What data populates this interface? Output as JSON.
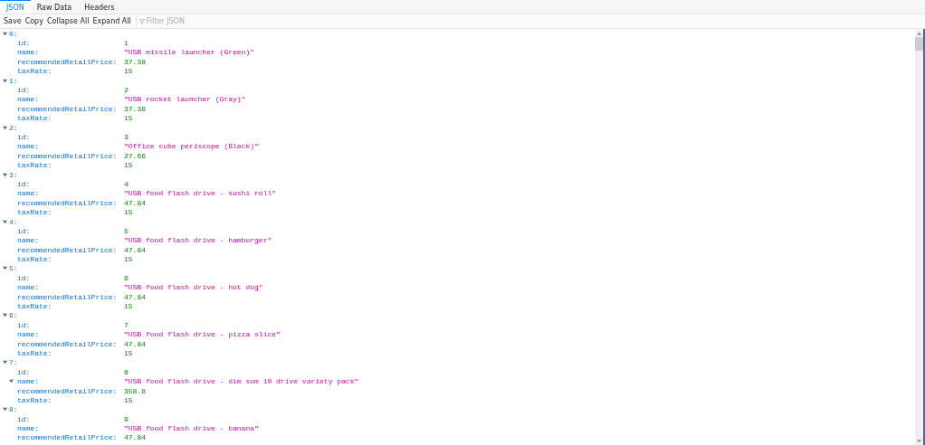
{
  "tabs": [
    {
      "label": "JSON",
      "selected": true
    },
    {
      "label": "Raw Data",
      "selected": false
    },
    {
      "label": "Headers",
      "selected": false
    }
  ],
  "toolbar": {
    "buttons": [
      "Save",
      "Copy",
      "Collapse All",
      "Expand All"
    ],
    "filter": {
      "placeholder": "Filter JSON"
    }
  },
  "items": [
    {
      "index": "0:",
      "fields": [
        {
          "key": "id:",
          "value": "1",
          "kind": "number"
        },
        {
          "key": "name:",
          "value": "\"USB missile launcher (Green)\"",
          "kind": "string"
        },
        {
          "key": "recommendedRetailPrice:",
          "value": "37.38",
          "kind": "number"
        },
        {
          "key": "taxRate:",
          "value": "15",
          "kind": "number"
        }
      ]
    },
    {
      "index": "1:",
      "fields": [
        {
          "key": "id:",
          "value": "2",
          "kind": "number"
        },
        {
          "key": "name:",
          "value": "\"USB rocket launcher (Gray)\"",
          "kind": "string"
        },
        {
          "key": "recommendedRetailPrice:",
          "value": "37.38",
          "kind": "number"
        },
        {
          "key": "taxRate:",
          "value": "15",
          "kind": "number"
        }
      ]
    },
    {
      "index": "2:",
      "fields": [
        {
          "key": "id:",
          "value": "3",
          "kind": "number"
        },
        {
          "key": "name:",
          "value": "\"Office cube periscope (Black)\"",
          "kind": "string"
        },
        {
          "key": "recommendedRetailPrice:",
          "value": "27.66",
          "kind": "number"
        },
        {
          "key": "taxRate:",
          "value": "15",
          "kind": "number"
        }
      ]
    },
    {
      "index": "3:",
      "fields": [
        {
          "key": "id:",
          "value": "4",
          "kind": "number"
        },
        {
          "key": "name:",
          "value": "\"USB food flash drive - sushi roll\"",
          "kind": "string"
        },
        {
          "key": "recommendedRetailPrice:",
          "value": "47.84",
          "kind": "number"
        },
        {
          "key": "taxRate:",
          "value": "15",
          "kind": "number"
        }
      ]
    },
    {
      "index": "4:",
      "fields": [
        {
          "key": "id:",
          "value": "5",
          "kind": "number"
        },
        {
          "key": "name:",
          "value": "\"USB food flash drive - hamburger\"",
          "kind": "string"
        },
        {
          "key": "recommendedRetailPrice:",
          "value": "47.84",
          "kind": "number"
        },
        {
          "key": "taxRate:",
          "value": "15",
          "kind": "number"
        }
      ]
    },
    {
      "index": "5:",
      "fields": [
        {
          "key": "id:",
          "value": "6",
          "kind": "number"
        },
        {
          "key": "name:",
          "value": "\"USB food flash drive - hot dog\"",
          "kind": "string"
        },
        {
          "key": "recommendedRetailPrice:",
          "value": "47.84",
          "kind": "number"
        },
        {
          "key": "taxRate:",
          "value": "15",
          "kind": "number"
        }
      ]
    },
    {
      "index": "6:",
      "fields": [
        {
          "key": "id:",
          "value": "7",
          "kind": "number"
        },
        {
          "key": "name:",
          "value": "\"USB food flash drive - pizza slice\"",
          "kind": "string"
        },
        {
          "key": "recommendedRetailPrice:",
          "value": "47.84",
          "kind": "number"
        },
        {
          "key": "taxRate:",
          "value": "15",
          "kind": "number"
        }
      ]
    },
    {
      "index": "7:",
      "fields": [
        {
          "key": "id:",
          "value": "8",
          "kind": "number"
        },
        {
          "key": "name:",
          "value": "\"USB food flash drive - dim sum 10 drive variety pack\"",
          "kind": "string",
          "twisty": true
        },
        {
          "key": "recommendedRetailPrice:",
          "value": "358.8",
          "kind": "number"
        },
        {
          "key": "taxRate:",
          "value": "15",
          "kind": "number"
        }
      ]
    },
    {
      "index": "8:",
      "fields": [
        {
          "key": "id:",
          "value": "9",
          "kind": "number"
        },
        {
          "key": "name:",
          "value": "\"USB food flash drive - banana\"",
          "kind": "string"
        },
        {
          "key": "recommendedRetailPrice:",
          "value": "47.84",
          "kind": "number"
        }
      ]
    }
  ]
}
